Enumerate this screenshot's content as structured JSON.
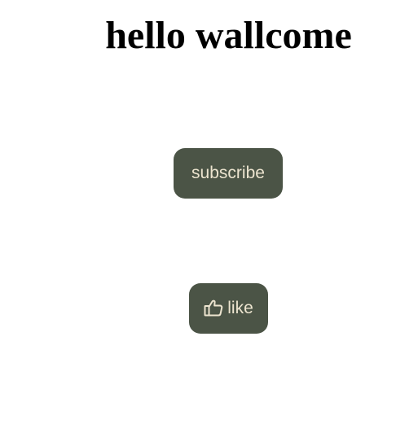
{
  "header": {
    "title": "hello wallcome"
  },
  "buttons": {
    "subscribe_label": "subscribe",
    "like_label": "like",
    "like_icon": "thumbs-up-icon"
  },
  "colors": {
    "button_background": "#4b5446",
    "button_text": "#ece4cf",
    "title_text": "#000000",
    "page_background": "#ffffff"
  }
}
